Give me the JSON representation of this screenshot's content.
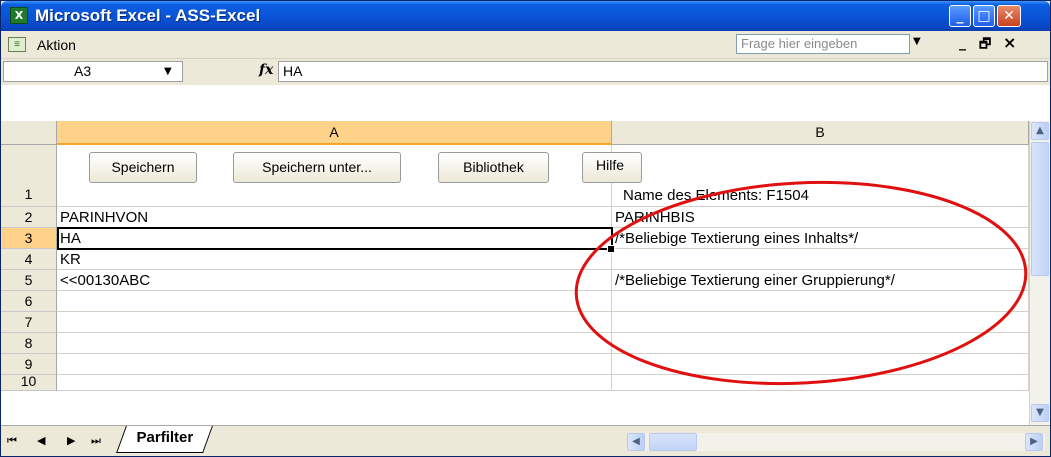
{
  "window": {
    "title": "Microsoft Excel - ASS-Excel",
    "app_icon_glyph": "X",
    "minimize": "_",
    "maximize": "□",
    "close": "✕"
  },
  "menubar": {
    "grip_icon": "≡",
    "menu_item": "Aktion",
    "help_placeholder": "Frage hier eingeben",
    "dropdown_arrow": "▼",
    "mdi_min": "_",
    "mdi_restore": "🗗",
    "mdi_close": "×"
  },
  "formula_bar": {
    "name_box": "A3",
    "fx": "fx",
    "formula": "HA"
  },
  "columns": [
    "A",
    "B"
  ],
  "rows": [
    {
      "num": "1",
      "a": "",
      "b": ""
    },
    {
      "num": "2",
      "a": "PARINHVON",
      "b": "PARINHBIS"
    },
    {
      "num": "3",
      "a": "HA",
      "b": "/*Beliebige Textierung eines Inhalts*/"
    },
    {
      "num": "4",
      "a": "KR",
      "b": ""
    },
    {
      "num": "5",
      "a": "<<00130ABC",
      "b": "/*Beliebige Textierung einer Gruppierung*/"
    },
    {
      "num": "6",
      "a": "",
      "b": ""
    },
    {
      "num": "7",
      "a": "",
      "b": ""
    },
    {
      "num": "8",
      "a": "",
      "b": ""
    },
    {
      "num": "9",
      "a": "",
      "b": ""
    }
  ],
  "partial_row_num": "10",
  "row1_text": "Name des Elements: F1504",
  "sheet_buttons": {
    "save": "Speichern",
    "save_as": "Speichern unter...",
    "library": "Bibliothek",
    "help": "Hilfe"
  },
  "sheet_tabs": [
    "Parfilter"
  ],
  "nav": {
    "first": "⏮",
    "prev": "◀",
    "next": "▶",
    "last": "⏭"
  },
  "colors": {
    "titlebar": "#0a54d8",
    "active_header": "#ffd28a",
    "annotation": "#e01010"
  }
}
